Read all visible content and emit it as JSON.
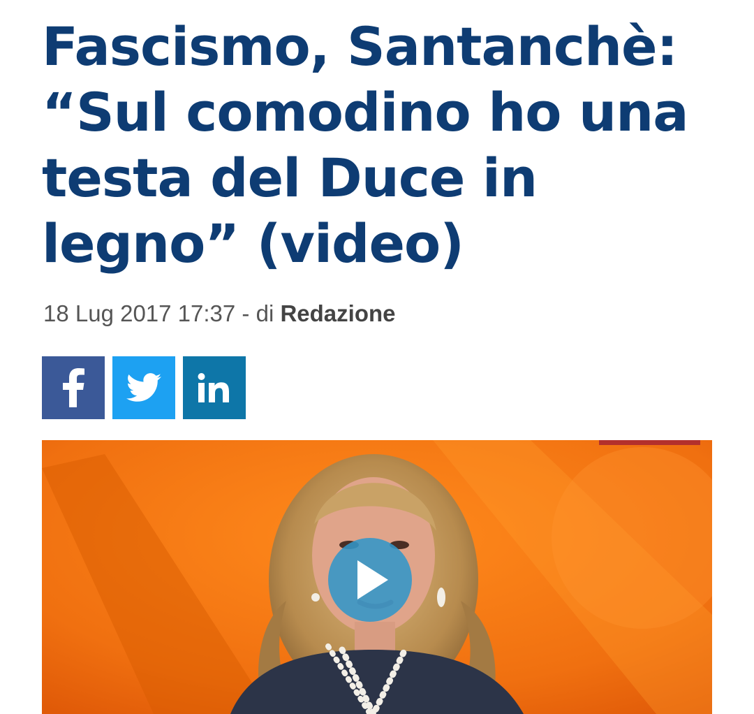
{
  "article": {
    "title": "Fascismo, Santanchè: “Sul comodino ho una testa del Duce in legno” (video)",
    "date": "18 Lug 2017 17:37",
    "separator": " - di ",
    "author": "Redazione"
  },
  "share": {
    "buttons": [
      {
        "network": "facebook",
        "icon": "facebook-icon",
        "color": "#3b5998"
      },
      {
        "network": "twitter",
        "icon": "twitter-icon",
        "color": "#1da1f2"
      },
      {
        "network": "linkedin",
        "icon": "linkedin-icon",
        "color": "#0e76a8"
      }
    ]
  },
  "video": {
    "play_icon": "play-icon",
    "play_color": "#2f93c8",
    "background_color": "#f07a10"
  }
}
